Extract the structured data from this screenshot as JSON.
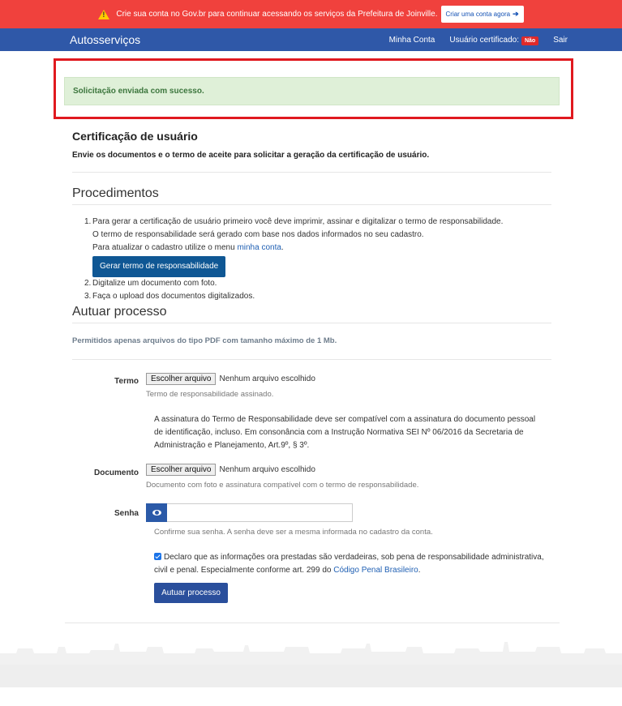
{
  "alert": {
    "text": "Crie sua conta no Gov.br para continuar acessando os serviços da Prefeitura de Joinville.",
    "cta": "Criar uma conta agora",
    "icon": "warning-icon",
    "color": "#f0413d"
  },
  "navbar": {
    "brand": "Autosserviços",
    "my_account": "Minha Conta",
    "certified_label": "Usuário certificado:",
    "certified_badge": "Não",
    "logout": "Sair",
    "color": "#2f58a8"
  },
  "success_message": "Solicitação enviada com sucesso.",
  "header": {
    "title": "Certificação de usuário",
    "subtitle": "Envie os documentos e o termo de aceite para solicitar a geração da certificação de usuário."
  },
  "procedures": {
    "title": "Procedimentos",
    "step1_line1": "Para gerar a certificação de usuário primeiro você deve imprimir, assinar e digitalizar o termo de responsabilidade.",
    "step1_line2": "O termo de responsabilidade será gerado com base nos dados informados no seu cadastro.",
    "step1_line3": "Para atualizar o cadastro utilize o menu",
    "step1_link": "minha conta",
    "generate_button": "Gerar termo de responsabilidade",
    "step2": "Digitalize um documento com foto.",
    "step3": "Faça o upload dos documentos digitalizados."
  },
  "process": {
    "title": "Autuar processo",
    "note": "Permitidos apenas arquivos do tipo PDF com tamanho máximo de 1 Mb.",
    "term_label": "Termo",
    "choose_file": "Escolher arquivo",
    "no_file": "Nenhum arquivo escolhido",
    "term_help": "Termo de responsabilidade assinado.",
    "term_paragraph": "A assinatura do Termo de Responsabilidade deve ser compatível com a assinatura do documento pessoal de identificação, incluso. Em consonância com a Instrução Normativa SEI Nº 06/2016 da Secretaria de Administração e Planejamento, Art.9º, § 3º.",
    "document_label": "Documento",
    "document_help": "Documento com foto e assinatura compatível com o termo de responsabilidade.",
    "password_label": "Senha",
    "password_help": "Confirme sua senha. A senha deve ser a mesma informada no cadastro da conta.",
    "declaration": "Declaro que as informações ora prestadas são verdadeiras, sob pena de responsabilidade administrativa, civil e penal. Especialmente conforme art. 299 do",
    "declaration_link": "Código Penal Brasileiro",
    "submit": "Autuar processo"
  }
}
